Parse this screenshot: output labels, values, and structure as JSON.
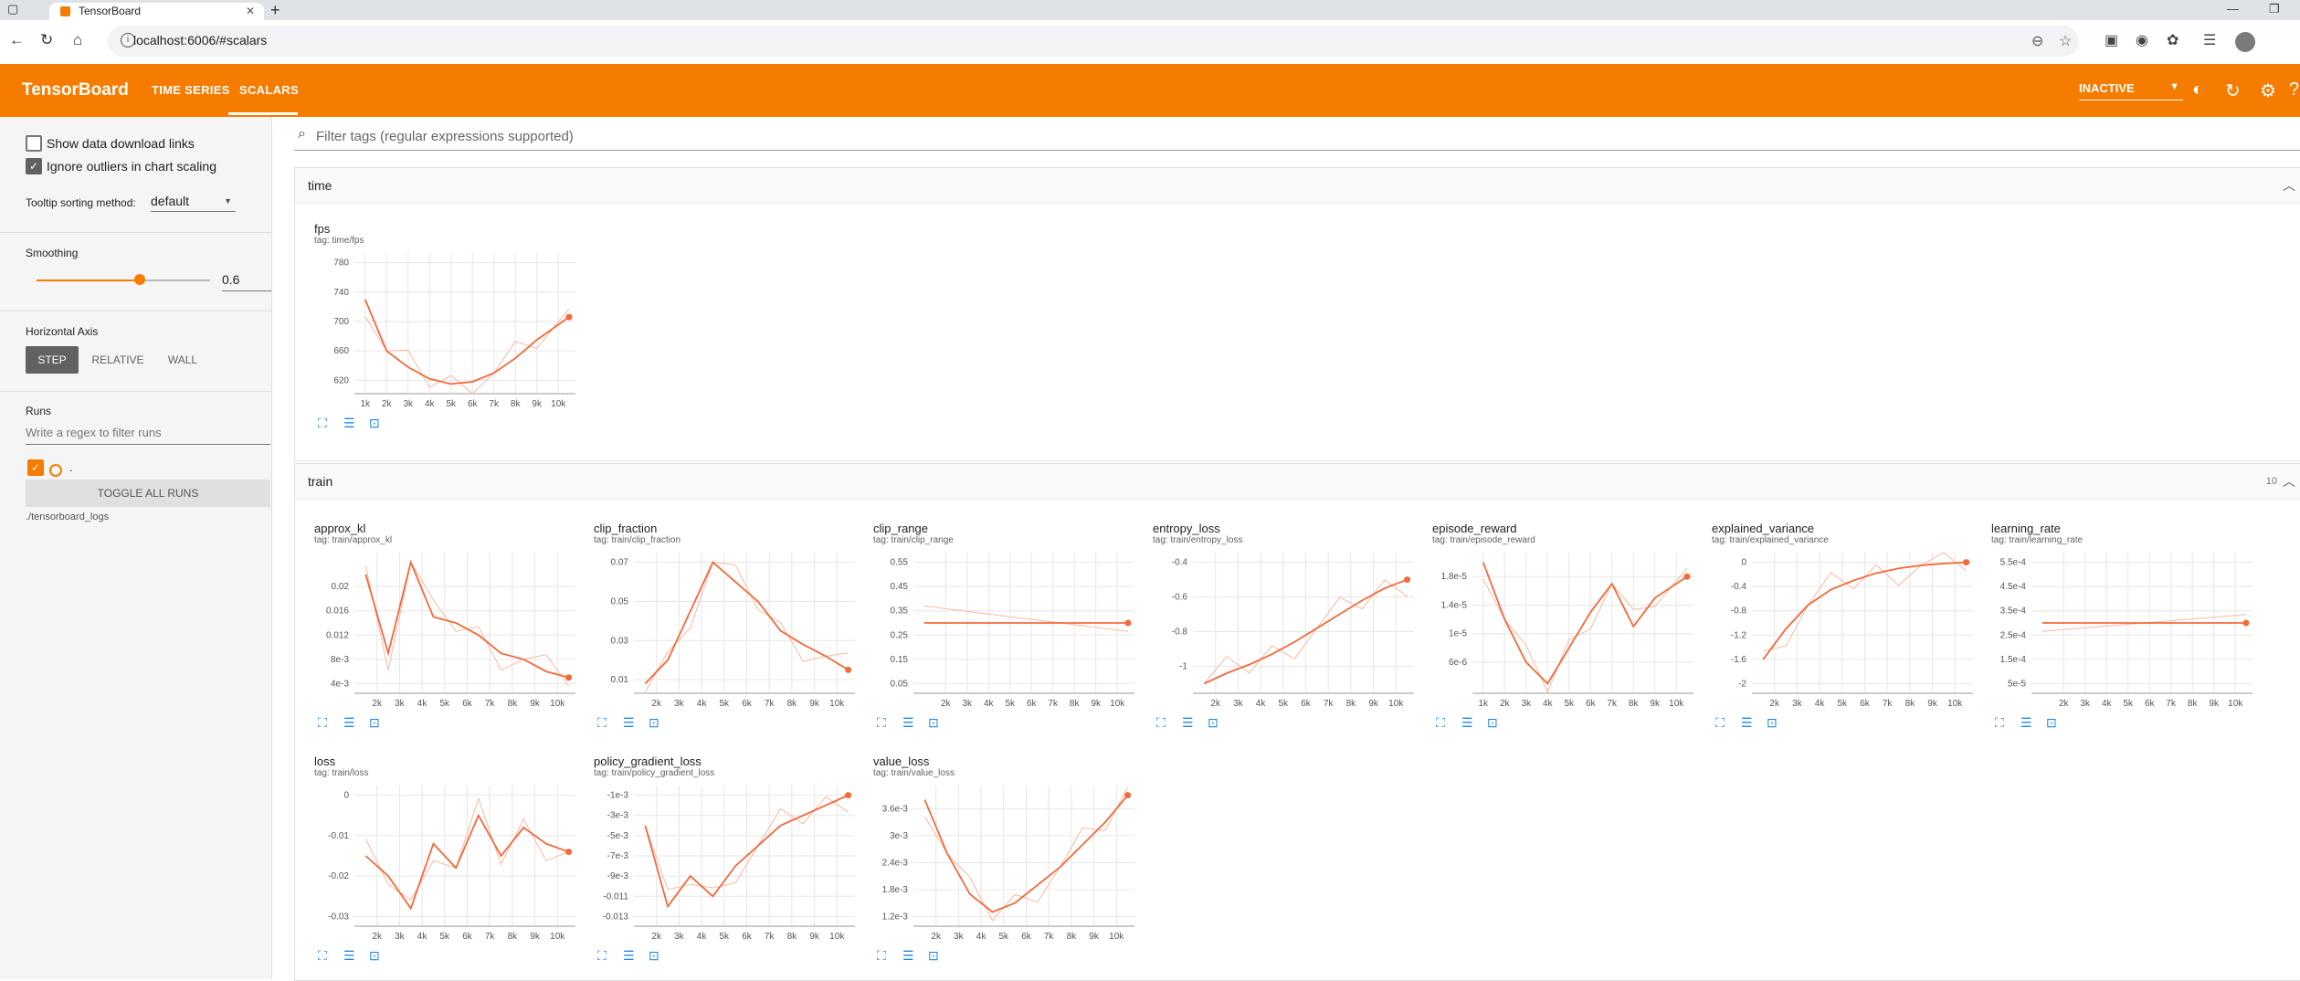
{
  "browser": {
    "tab_title": "TensorBoard",
    "url": "localhost:6006/#scalars",
    "icons": [
      "back-arrow-icon",
      "reload-icon",
      "home-icon",
      "zoom-icon",
      "star-icon",
      "extension-icon",
      "profile-avatar"
    ]
  },
  "header": {
    "brand": "TensorBoard",
    "tabs": [
      {
        "label": "TIME SERIES"
      },
      {
        "label": "SCALARS"
      }
    ],
    "active_tab": "SCALARS",
    "status": "INACTIVE",
    "color": "#f57c00"
  },
  "sidebar": {
    "show_download_links": "Show data download links",
    "ignore_outliers": "Ignore outliers in chart scaling",
    "tooltip_label": "Tooltip sorting method:",
    "tooltip_value": "default",
    "smoothing_label": "Smoothing",
    "smoothing_value": "0.6",
    "smoothing_fraction": 0.6,
    "horizontal_axis_label": "Horizontal Axis",
    "axis_options": [
      "STEP",
      "RELATIVE",
      "WALL"
    ],
    "axis_selected": "STEP",
    "runs_label": "Runs",
    "runs_placeholder": "Write a regex to filter runs",
    "run_name": ".",
    "toggle_all": "TOGGLE ALL RUNS",
    "logdir": "./tensorboard_logs"
  },
  "filter": {
    "placeholder": "Filter tags (regular expressions supported)"
  },
  "groups": [
    {
      "name": "time",
      "count": ""
    },
    {
      "name": "train",
      "count": "10"
    }
  ],
  "chart_data": [
    {
      "type": "line",
      "title": "fps",
      "tag": "tag: time/fps",
      "x_ticks": [
        "1k",
        "2k",
        "3k",
        "4k",
        "5k",
        "6k",
        "7k",
        "8k",
        "9k",
        "10k"
      ],
      "y_ticks": [
        "620",
        "660",
        "700",
        "740",
        "780"
      ],
      "x": [
        1000,
        2000,
        3000,
        4000,
        5000,
        6000,
        7000,
        8000,
        9000,
        10500
      ],
      "y": [
        730,
        660,
        638,
        622,
        615,
        618,
        630,
        650,
        675,
        706
      ]
    },
    {
      "type": "line",
      "title": "approx_kl",
      "tag": "tag: train/approx_kl",
      "x_ticks": [
        "2k",
        "3k",
        "4k",
        "5k",
        "6k",
        "7k",
        "8k",
        "9k",
        "10k"
      ],
      "y_ticks": [
        "4e-3",
        "8e-3",
        "0.012",
        "0.016",
        "0.02"
      ],
      "x": [
        1500,
        2500,
        3500,
        4500,
        5500,
        6500,
        7500,
        8500,
        9500,
        10500
      ],
      "y": [
        0.022,
        0.009,
        0.024,
        0.015,
        0.014,
        0.012,
        0.009,
        0.008,
        0.006,
        0.005
      ]
    },
    {
      "type": "line",
      "title": "clip_fraction",
      "tag": "tag: train/clip_fraction",
      "x_ticks": [
        "2k",
        "3k",
        "4k",
        "5k",
        "6k",
        "7k",
        "8k",
        "9k",
        "10k"
      ],
      "y_ticks": [
        "0.01",
        "0.03",
        "0.05",
        "0.07"
      ],
      "x": [
        1500,
        2500,
        3500,
        4500,
        5500,
        6500,
        7500,
        8500,
        9500,
        10500
      ],
      "y": [
        0.008,
        0.02,
        0.045,
        0.07,
        0.06,
        0.05,
        0.035,
        0.028,
        0.022,
        0.015
      ]
    },
    {
      "type": "line",
      "title": "clip_range",
      "tag": "tag: train/clip_range",
      "x_ticks": [
        "2k",
        "3k",
        "4k",
        "5k",
        "6k",
        "7k",
        "8k",
        "9k",
        "10k"
      ],
      "y_ticks": [
        "0.05",
        "0.15",
        "0.25",
        "0.35",
        "0.45",
        "0.55"
      ],
      "x": [
        1000,
        10500
      ],
      "y": [
        0.3,
        0.3
      ]
    },
    {
      "type": "line",
      "title": "entropy_loss",
      "tag": "tag: train/entropy_loss",
      "x_ticks": [
        "2k",
        "3k",
        "4k",
        "5k",
        "6k",
        "7k",
        "8k",
        "9k",
        "10k"
      ],
      "y_ticks": [
        "-1",
        "-0.8",
        "-0.6",
        "-0.4"
      ],
      "x": [
        1500,
        2500,
        3500,
        4500,
        5500,
        6500,
        7500,
        8500,
        9500,
        10500
      ],
      "y": [
        -1.1,
        -1.04,
        -0.99,
        -0.93,
        -0.86,
        -0.78,
        -0.7,
        -0.62,
        -0.55,
        -0.5
      ]
    },
    {
      "type": "line",
      "title": "episode_reward",
      "tag": "tag: train/episode_reward",
      "x_ticks": [
        "1k",
        "2k",
        "3k",
        "4k",
        "5k",
        "6k",
        "7k",
        "8k",
        "9k",
        "10k"
      ],
      "y_ticks": [
        "6e-6",
        "1e-5",
        "1.4e-5",
        "1.8e-5"
      ],
      "x": [
        1000,
        2000,
        3000,
        4000,
        5000,
        6000,
        7000,
        8000,
        9000,
        10500
      ],
      "y": [
        2e-05,
        1.2e-05,
        6e-06,
        3e-06,
        8e-06,
        1.3e-05,
        1.7e-05,
        1.1e-05,
        1.5e-05,
        1.8e-05
      ]
    },
    {
      "type": "line",
      "title": "explained_variance",
      "tag": "tag: train/explained_variance",
      "x_ticks": [
        "2k",
        "3k",
        "4k",
        "5k",
        "6k",
        "7k",
        "8k",
        "9k",
        "10k"
      ],
      "y_ticks": [
        "-2",
        "-1.6",
        "-1.2",
        "-0.8",
        "-0.4",
        "0"
      ],
      "x": [
        1500,
        2500,
        3500,
        4500,
        5500,
        6500,
        7500,
        8500,
        9500,
        10500
      ],
      "y": [
        -1.6,
        -1.1,
        -0.7,
        -0.45,
        -0.3,
        -0.18,
        -0.1,
        -0.05,
        -0.02,
        0
      ]
    },
    {
      "type": "line",
      "title": "learning_rate",
      "tag": "tag: train/learning_rate",
      "x_ticks": [
        "2k",
        "3k",
        "4k",
        "5k",
        "6k",
        "7k",
        "8k",
        "9k",
        "10k"
      ],
      "y_ticks": [
        "5e-5",
        "1.5e-4",
        "2.5e-4",
        "3.5e-4",
        "4.5e-4",
        "5.5e-4"
      ],
      "x": [
        1000,
        10500
      ],
      "y": [
        0.0003,
        0.0003
      ]
    },
    {
      "type": "line",
      "title": "loss",
      "tag": "tag: train/loss",
      "x_ticks": [
        "2k",
        "3k",
        "4k",
        "5k",
        "6k",
        "7k",
        "8k",
        "9k",
        "10k"
      ],
      "y_ticks": [
        "-0.03",
        "-0.02",
        "-0.01",
        "0"
      ],
      "x": [
        1500,
        2500,
        3500,
        4500,
        5500,
        6500,
        7500,
        8500,
        9500,
        10500
      ],
      "y": [
        -0.015,
        -0.02,
        -0.028,
        -0.012,
        -0.018,
        -0.005,
        -0.015,
        -0.008,
        -0.012,
        -0.014
      ]
    },
    {
      "type": "line",
      "title": "policy_gradient_loss",
      "tag": "tag: train/policy_gradient_loss",
      "x_ticks": [
        "2k",
        "3k",
        "4k",
        "5k",
        "6k",
        "7k",
        "8k",
        "9k",
        "10k"
      ],
      "y_ticks": [
        "-0.013",
        "-0.011",
        "-9e-3",
        "-7e-3",
        "-5e-3",
        "-3e-3",
        "-1e-3"
      ],
      "x": [
        1500,
        2500,
        3500,
        4500,
        5500,
        6500,
        7500,
        8500,
        9500,
        10500
      ],
      "y": [
        -0.004,
        -0.012,
        -0.009,
        -0.011,
        -0.008,
        -0.006,
        -0.004,
        -0.003,
        -0.002,
        -0.001
      ]
    },
    {
      "type": "line",
      "title": "value_loss",
      "tag": "tag: train/value_loss",
      "x_ticks": [
        "2k",
        "3k",
        "4k",
        "5k",
        "6k",
        "7k",
        "8k",
        "9k",
        "10k"
      ],
      "y_ticks": [
        "1.2e-3",
        "1.8e-3",
        "2.4e-3",
        "3e-3",
        "3.6e-3"
      ],
      "x": [
        1500,
        2500,
        3500,
        4500,
        5500,
        6500,
        7500,
        8500,
        9500,
        10500
      ],
      "y": [
        0.0038,
        0.0026,
        0.0017,
        0.0013,
        0.0015,
        0.0019,
        0.0023,
        0.0028,
        0.0033,
        0.0039
      ]
    }
  ]
}
